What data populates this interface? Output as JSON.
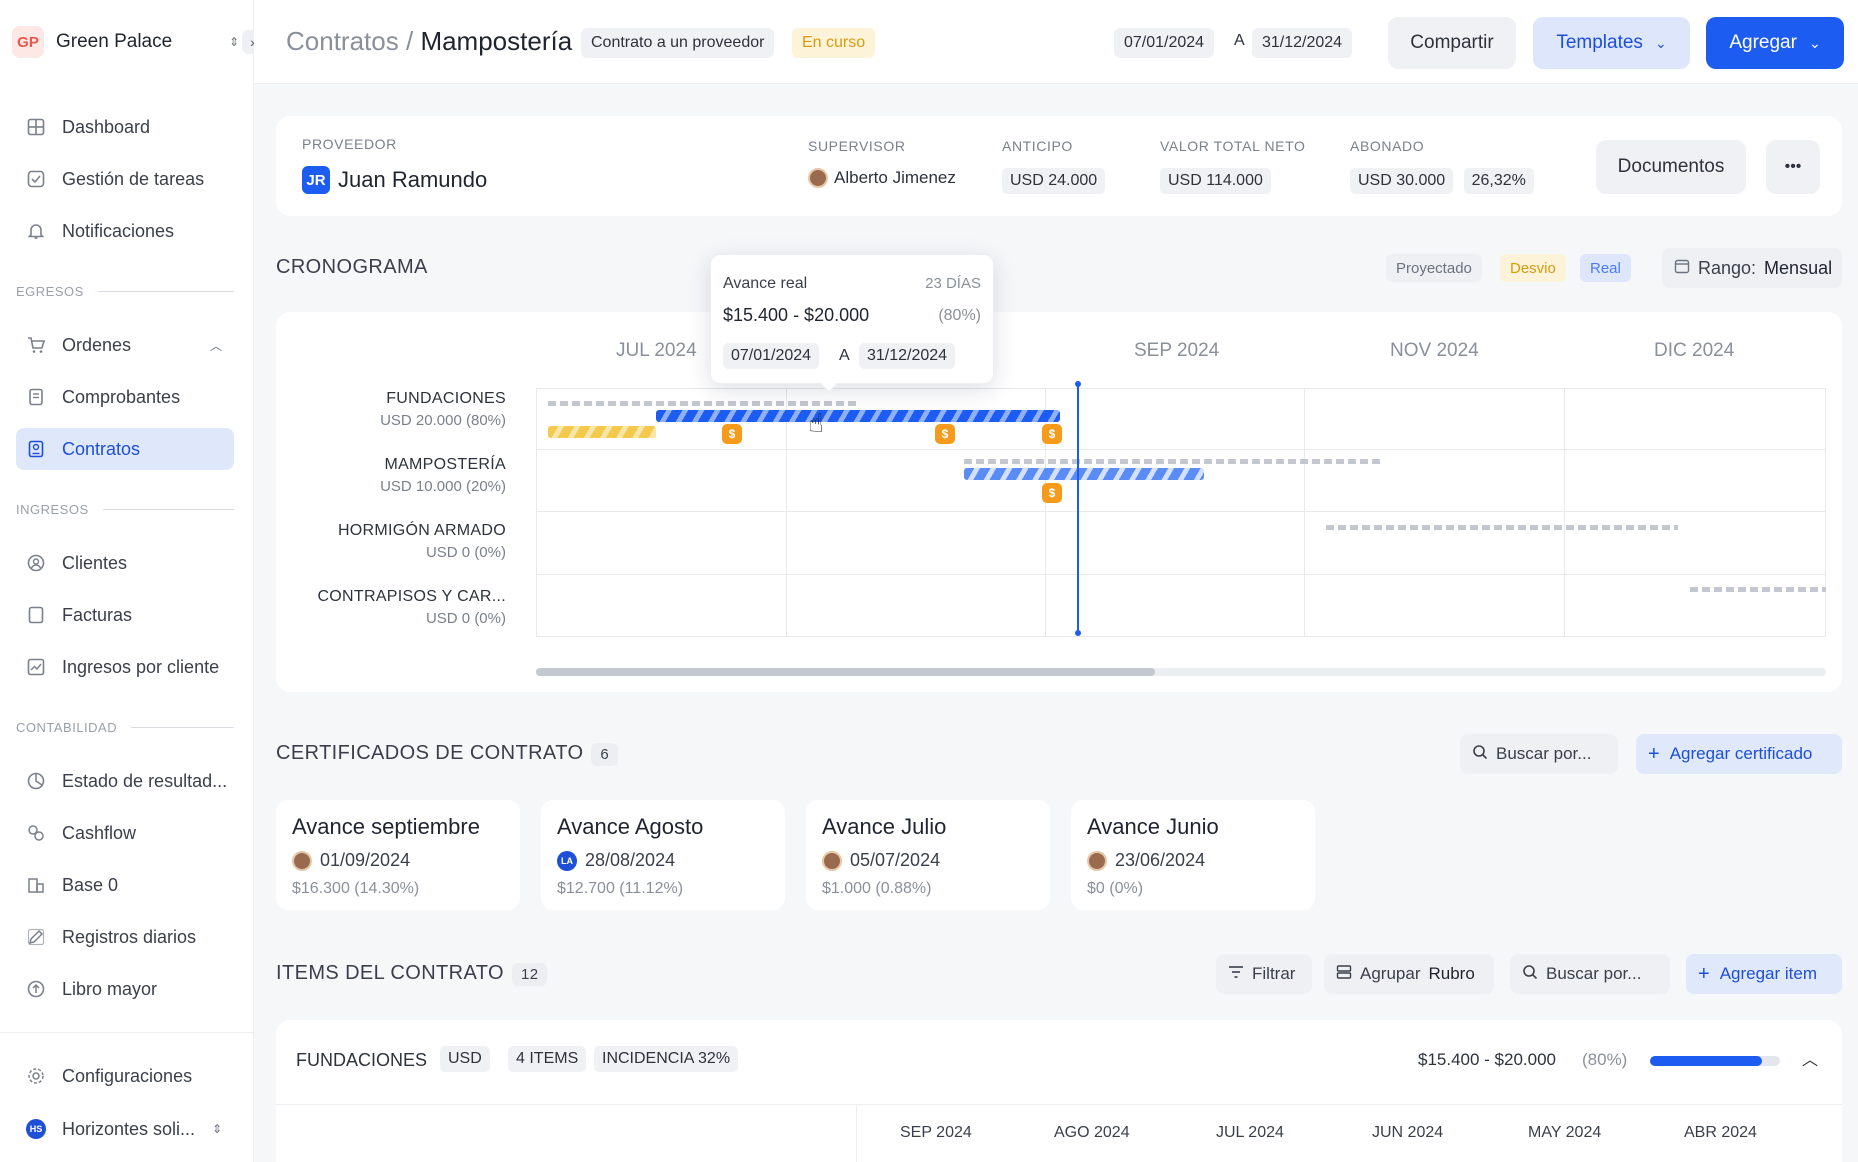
{
  "workspace": {
    "initials": "GP",
    "name": "Green Palace"
  },
  "sidebar": {
    "items_top": [
      {
        "label": "Dashboard",
        "icon": "grid-icon"
      },
      {
        "label": "Gestión de tareas",
        "icon": "checkbox-icon"
      },
      {
        "label": "Notificaciones",
        "icon": "bell-icon"
      }
    ],
    "sections": {
      "egresos": "EGRESOS",
      "ingresos": "INGRESOS",
      "contabilidad": "CONTABILIDAD"
    },
    "egresos_items": [
      {
        "label": "Ordenes",
        "icon": "cart-icon"
      },
      {
        "label": "Comprobantes",
        "icon": "receipt-icon"
      },
      {
        "label": "Contratos",
        "icon": "contract-icon"
      }
    ],
    "ingresos_items": [
      {
        "label": "Clientes",
        "icon": "user-circle-icon"
      },
      {
        "label": "Facturas",
        "icon": "invoice-icon"
      },
      {
        "label": "Ingresos por cliente",
        "icon": "chart-icon"
      }
    ],
    "contabilidad_items": [
      {
        "label": "Estado de resultad...",
        "icon": "pie-icon"
      },
      {
        "label": "Cashflow",
        "icon": "cashflow-icon"
      },
      {
        "label": "Base 0",
        "icon": "building-icon"
      },
      {
        "label": "Registros diarios",
        "icon": "edit-icon"
      },
      {
        "label": "Libro mayor",
        "icon": "ledger-icon"
      }
    ],
    "settings_label": "Configuraciones",
    "org": {
      "initials": "HS",
      "name": "Horizontes soli..."
    }
  },
  "header": {
    "crumb_parent": "Contratos",
    "crumb_sep": "/",
    "crumb_current": "Mampostería",
    "type_chip": "Contrato a un proveedor",
    "status_chip": "En curso",
    "date_from": "07/01/2024",
    "date_sep": "A",
    "date_to": "31/12/2024",
    "share_label": "Compartir",
    "templates_label": "Templates",
    "add_label": "Agregar"
  },
  "summary": {
    "provider_label": "PROVEEDOR",
    "provider_initials": "JR",
    "provider_name": "Juan Ramundo",
    "supervisor_label": "SUPERVISOR",
    "supervisor_name": "Alberto Jimenez",
    "advance_label": "ANTICIPO",
    "advance_value": "USD 24.000",
    "total_label": "VALOR TOTAL NETO",
    "total_value": "USD 114.000",
    "paid_label": "ABONADO",
    "paid_value": "USD 30.000",
    "paid_pct": "26,32%",
    "documents_label": "Documentos",
    "more_label": "•••"
  },
  "schedule": {
    "title": "CRONOGRAMA",
    "legend": {
      "projected": "Proyectado",
      "deviation": "Desvio",
      "real": "Real"
    },
    "range_label": "Rango:",
    "range_value": "Mensual",
    "months": [
      "JUL 2024",
      "SEP 2024",
      "NOV 2024",
      "DIC 2024"
    ],
    "rows": [
      {
        "name": "FUNDACIONES",
        "sub": "USD 20.000 (80%)"
      },
      {
        "name": "MAMPOSTERÍA",
        "sub": "USD 10.000 (20%)"
      },
      {
        "name": "HORMIGÓN ARMADO",
        "sub": "USD 0 (0%)"
      },
      {
        "name": "CONTRAPISOS Y CAR...",
        "sub": "USD 0 (0%)"
      }
    ],
    "pay_symbol": "$",
    "scroll_fraction": 0.48,
    "tooltip": {
      "title": "Avance real",
      "days": "23 DÍAS",
      "range": "$15.400  -  $20.000",
      "pct": "(80%)",
      "from": "07/01/2024",
      "sep": "A",
      "to": "31/12/2024"
    }
  },
  "certificates": {
    "title": "CERTIFICADOS DE CONTRATO",
    "count": "6",
    "search_placeholder": "Buscar por...",
    "add_label": "Agregar certificado",
    "items": [
      {
        "title": "Avance septiembre",
        "date": "01/09/2024",
        "amount": "$16.300",
        "pct": "(14.30%)",
        "author": "photo"
      },
      {
        "title": "Avance Agosto",
        "date": "28/08/2024",
        "amount": "$12.700",
        "pct": "(11.12%)",
        "author": "LA"
      },
      {
        "title": "Avance Julio",
        "date": "05/07/2024",
        "amount": "$1.000",
        "pct": "(0.88%)",
        "author": "photo"
      },
      {
        "title": "Avance Junio",
        "date": "23/06/2024",
        "amount": "$0",
        "pct": "(0%)",
        "author": "photo"
      }
    ]
  },
  "items": {
    "title": "ITEMS DEL CONTRATO",
    "count": "12",
    "filter_label": "Filtrar",
    "group_label": "Agrupar",
    "group_value": "Rubro",
    "search_placeholder": "Buscar por...",
    "add_label": "Agregar item",
    "group": {
      "name": "FUNDACIONES",
      "currency": "USD",
      "items_count": "4 ITEMS",
      "incidence": "INCIDENCIA 32%",
      "range": "$15.400  -  $20.000",
      "pct": "(80%)",
      "progress": 0.86
    },
    "months": [
      "SEP 2024",
      "AGO 2024",
      "JUL 2024",
      "JUN 2024",
      "MAY 2024",
      "ABR 2024"
    ]
  },
  "colors": {
    "accent": "#1d5cf0",
    "warn": "#f59a1b",
    "active_bg": "#dfe7fb"
  }
}
